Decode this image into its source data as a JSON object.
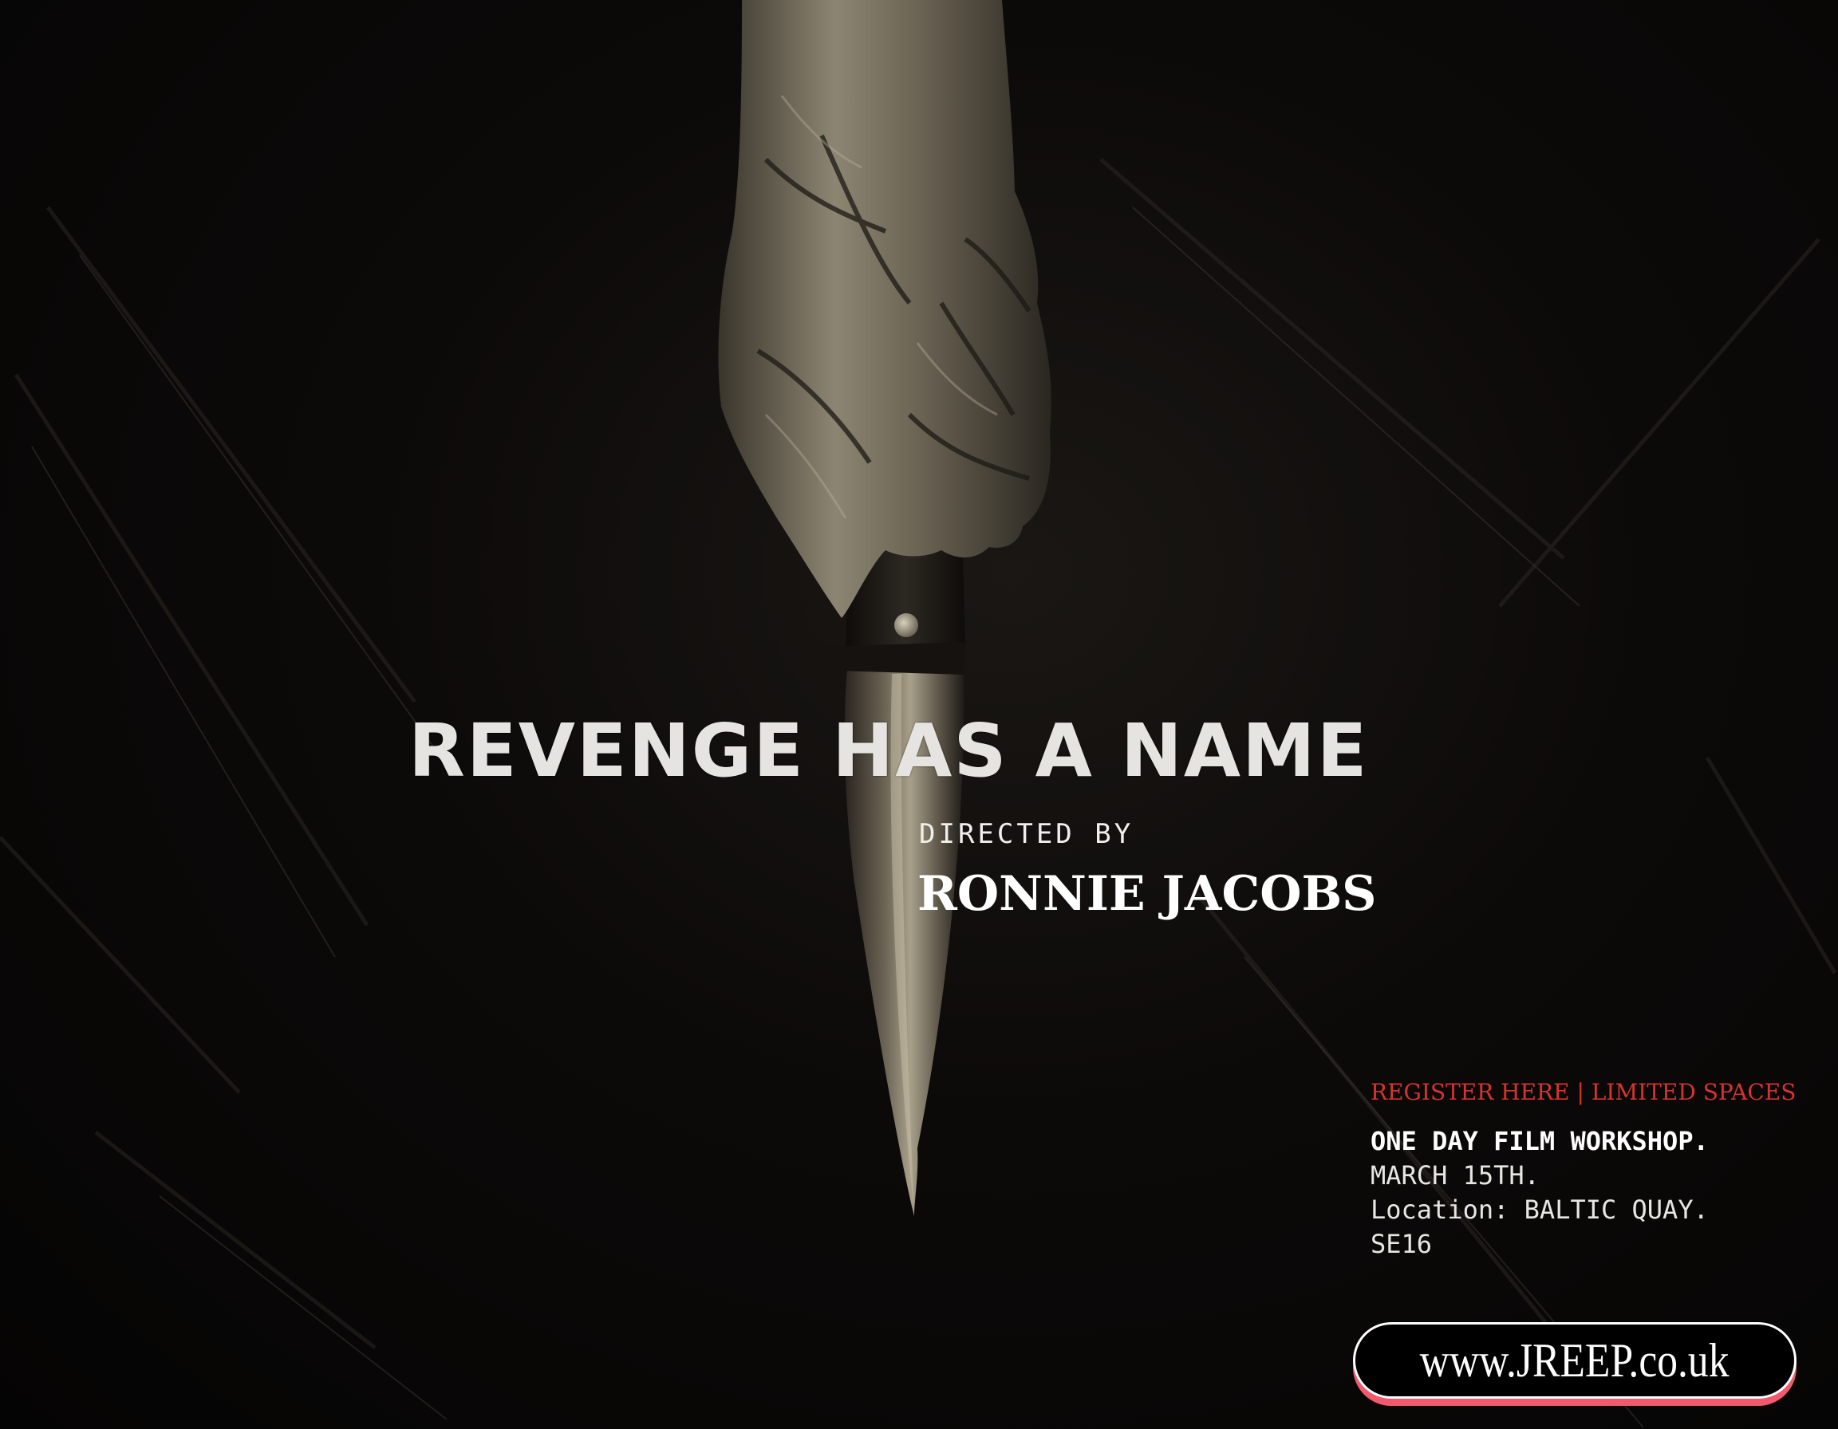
{
  "poster": {
    "title": "REVENGE HAS A NAME",
    "directed_by_label": "DIRECTED BY",
    "director": "RONNIE JACOBS"
  },
  "event": {
    "register_line": "REGISTER HERE | LIMITED SPACES",
    "headline": "ONE DAY FILM WORKSHOP.",
    "date": "MARCH 15TH.",
    "location": "Location: BALTIC QUAY.",
    "postcode": "SE16"
  },
  "website": {
    "url": "www.JREEP.co.uk"
  },
  "colors": {
    "background": "#050404",
    "accent_red": "#d7332d",
    "pill_shadow": "#f2596c",
    "text": "#ffffff"
  },
  "icons": {
    "hero_image": "hand-holding-knife-photo"
  }
}
